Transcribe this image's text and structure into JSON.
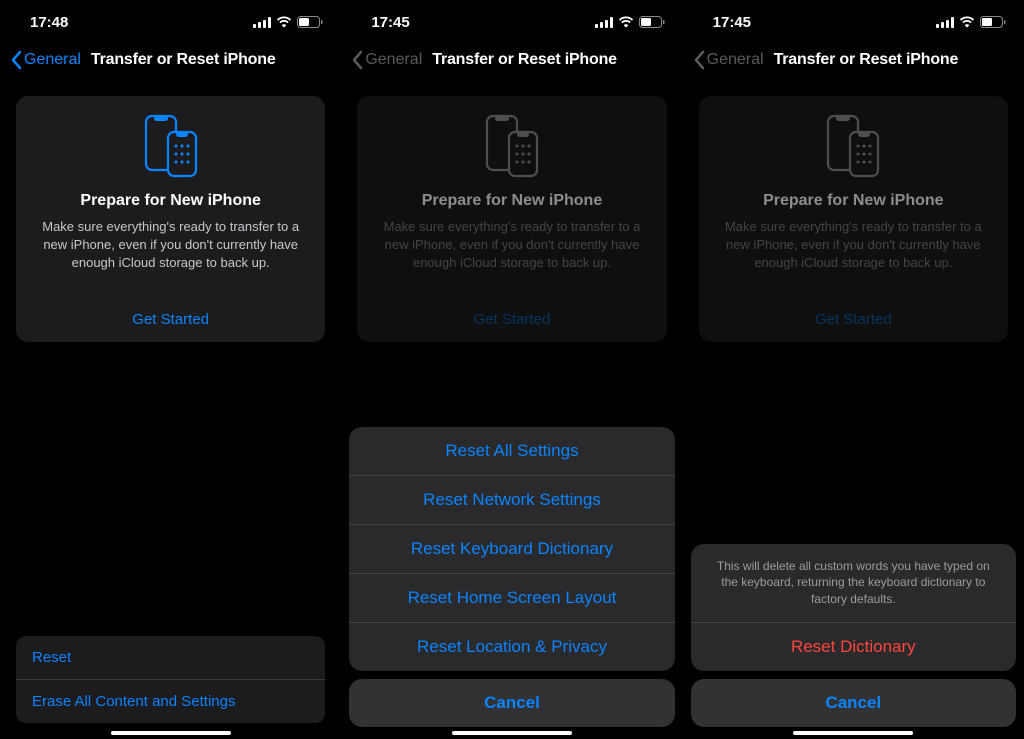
{
  "screens": [
    {
      "time": "17:48",
      "back_label": "General",
      "title": "Transfer or Reset iPhone",
      "active": true,
      "card": {
        "heading": "Prepare for New iPhone",
        "body": "Make sure everything's ready to transfer to a new iPhone, even if you don't currently have enough iCloud storage to back up.",
        "cta": "Get Started"
      },
      "bottom": {
        "reset": "Reset",
        "erase": "Erase All Content and Settings"
      }
    },
    {
      "time": "17:45",
      "back_label": "General",
      "title": "Transfer or Reset iPhone",
      "active": false,
      "card": {
        "heading": "Prepare for New iPhone",
        "body": "Make sure everything's ready to transfer to a new iPhone, even if you don't currently have enough iCloud storage to back up.",
        "cta": "Get Started"
      },
      "sheet": {
        "options": [
          "Reset All Settings",
          "Reset Network Settings",
          "Reset Keyboard Dictionary",
          "Reset Home Screen Layout",
          "Reset Location & Privacy"
        ],
        "cancel": "Cancel"
      }
    },
    {
      "time": "17:45",
      "back_label": "General",
      "title": "Transfer or Reset iPhone",
      "active": false,
      "card": {
        "heading": "Prepare for New iPhone",
        "body": "Make sure everything's ready to transfer to a new iPhone, even if you don't currently have enough iCloud storage to back up.",
        "cta": "Get Started"
      },
      "confirm": {
        "message": "This will delete all custom words you have typed on the keyboard, returning the keyboard dictionary to factory defaults.",
        "destructive": "Reset Dictionary",
        "cancel": "Cancel"
      }
    }
  ]
}
